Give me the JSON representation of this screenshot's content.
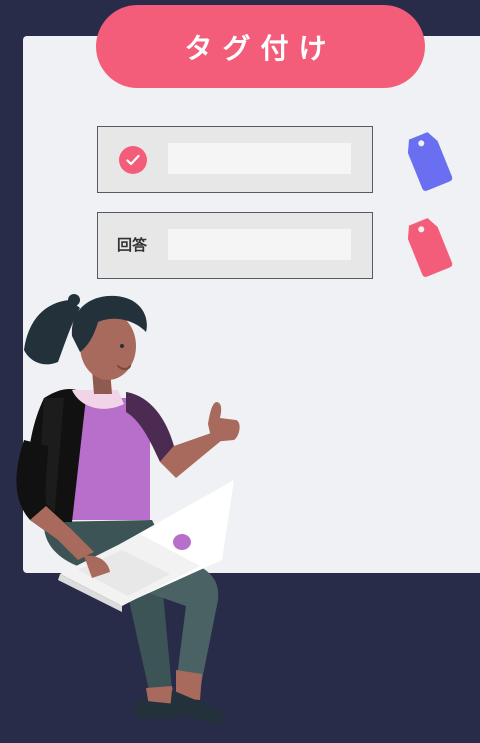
{
  "title": "タグ付け",
  "rows": [
    {
      "icon": "check-circle-icon",
      "label": ""
    },
    {
      "icon": "",
      "label": "回答"
    }
  ],
  "tags": [
    {
      "icon": "tag-icon",
      "color": "#6a6ff2"
    },
    {
      "icon": "tag-icon",
      "color": "#f45d7a"
    }
  ],
  "colors": {
    "background": "#282c49",
    "card": "#f0f1f4",
    "accent": "#f45d7a",
    "tag_blue": "#6a6ff2"
  }
}
